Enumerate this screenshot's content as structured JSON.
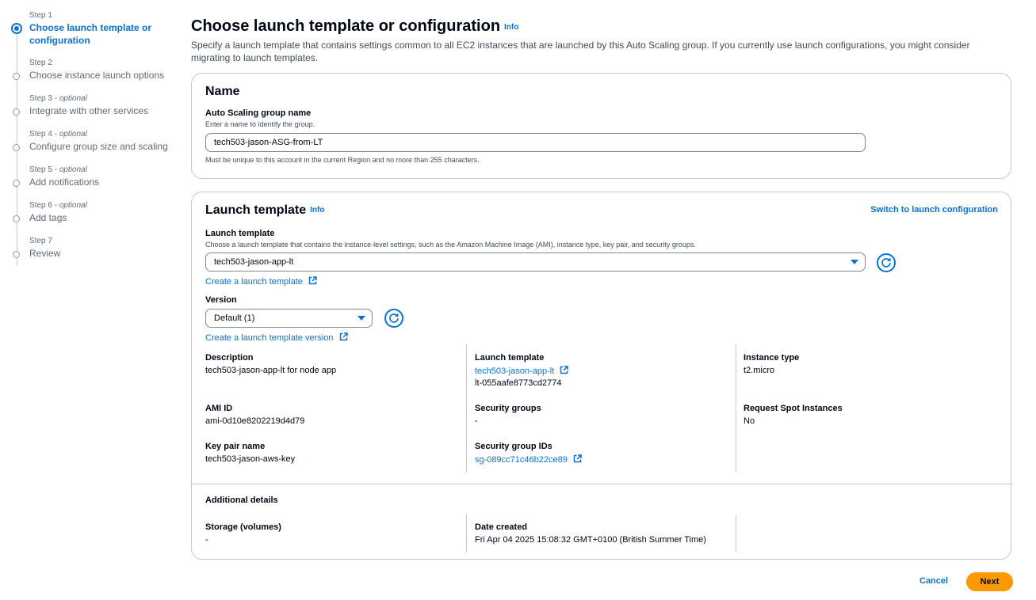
{
  "steps": [
    {
      "num": "Step 1",
      "optional": "",
      "name": "Choose launch template or configuration"
    },
    {
      "num": "Step 2",
      "optional": "",
      "name": "Choose instance launch options"
    },
    {
      "num": "Step 3 - ",
      "optional": "optional",
      "name": "Integrate with other services"
    },
    {
      "num": "Step 4 - ",
      "optional": "optional",
      "name": "Configure group size and scaling"
    },
    {
      "num": "Step 5 - ",
      "optional": "optional",
      "name": "Add notifications"
    },
    {
      "num": "Step 6 - ",
      "optional": "optional",
      "name": "Add tags"
    },
    {
      "num": "Step 7",
      "optional": "",
      "name": "Review"
    }
  ],
  "header": {
    "title": "Choose launch template or configuration",
    "info": "Info",
    "description": "Specify a launch template that contains settings common to all EC2 instances that are launched by this Auto Scaling group. If you currently use launch configurations, you might consider migrating to launch templates."
  },
  "name_panel": {
    "title": "Name",
    "field_label": "Auto Scaling group name",
    "field_desc": "Enter a name to identify the group.",
    "field_value": "tech503-jason-ASG-from-LT",
    "constraint": "Must be unique to this account in the current Region and no more than 255 characters."
  },
  "lt_panel": {
    "title": "Launch template",
    "info": "Info",
    "switch_link": "Switch to launch configuration",
    "lt_label": "Launch template",
    "lt_desc": "Choose a launch template that contains the instance-level settings, such as the Amazon Machine Image (AMI), instance type, key pair, and security groups.",
    "lt_value": "tech503-jason-app-lt",
    "create_lt_link": "Create a launch template",
    "version_label": "Version",
    "version_value": "Default (1)",
    "create_version_link": "Create a launch template version",
    "details": {
      "description_label": "Description",
      "description_value": "tech503-jason-app-lt for node app",
      "lt_label": "Launch template",
      "lt_link": "tech503-jason-app-lt",
      "lt_id": "lt-055aafe8773cd2774",
      "instance_type_label": "Instance type",
      "instance_type_value": "t2.micro",
      "ami_label": "AMI ID",
      "ami_value": "ami-0d10e8202219d4d79",
      "sg_label": "Security groups",
      "sg_value": "-",
      "spot_label": "Request Spot Instances",
      "spot_value": "No",
      "key_label": "Key pair name",
      "key_value": "tech503-jason-aws-key",
      "sg_ids_label": "Security group IDs",
      "sg_ids_link": "sg-089cc71c46b22ce89"
    },
    "additional": {
      "title": "Additional details",
      "storage_label": "Storage (volumes)",
      "storage_value": "-",
      "date_label": "Date created",
      "date_value": "Fri Apr 04 2025 15:08:32 GMT+0100 (British Summer Time)"
    }
  },
  "footer": {
    "cancel": "Cancel",
    "next": "Next"
  },
  "colors": {
    "accent": "#0972d3",
    "primary_button": "#ff9900",
    "border": "#c6c6cd"
  }
}
